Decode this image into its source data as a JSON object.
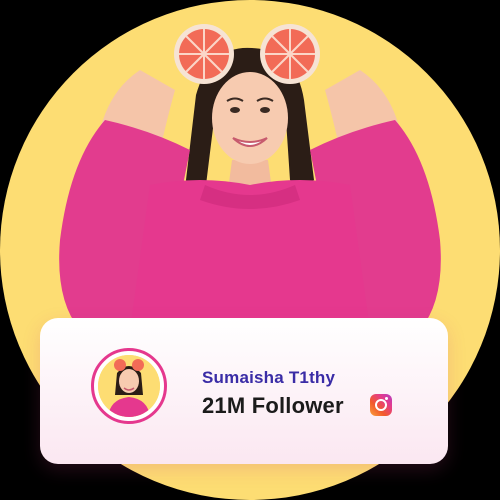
{
  "profile": {
    "name": "Sumaisha T1thy",
    "followers": "21M Follower",
    "platform_icon": "instagram-icon"
  },
  "colors": {
    "background_circle": "#FDDD73",
    "sweater": "#E5388E",
    "name_text": "#3A2CA6",
    "follower_text": "#1B1B1B",
    "grapefruit": "#F26B57"
  }
}
